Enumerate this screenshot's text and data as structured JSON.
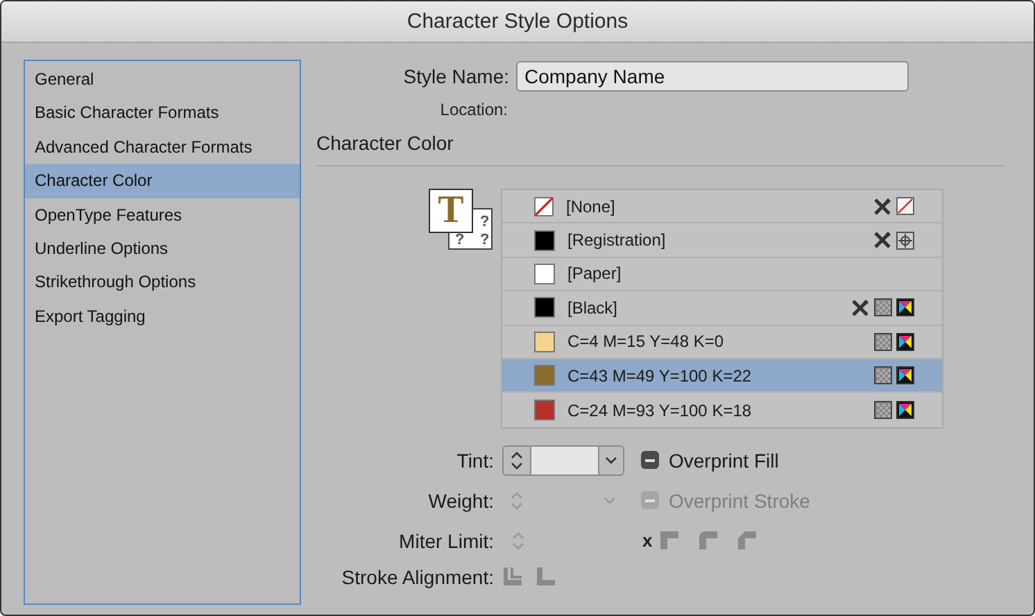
{
  "window": {
    "title": "Character Style Options"
  },
  "sidebar": {
    "items": [
      {
        "label": "General",
        "selected": false
      },
      {
        "label": "Basic Character Formats",
        "selected": false
      },
      {
        "label": "Advanced Character Formats",
        "selected": false
      },
      {
        "label": "Character Color",
        "selected": true
      },
      {
        "label": "OpenType Features",
        "selected": false
      },
      {
        "label": "Underline Options",
        "selected": false
      },
      {
        "label": "Strikethrough Options",
        "selected": false
      },
      {
        "label": "Export Tagging",
        "selected": false
      }
    ]
  },
  "style_name": {
    "label": "Style Name:",
    "value": "Company Name"
  },
  "location": {
    "label": "Location:"
  },
  "section_title": "Character Color",
  "fill_stroke": {
    "fill_letter": "T",
    "stroke_marks": [
      "?",
      "?",
      "?"
    ]
  },
  "swatches": [
    {
      "name": "[None]",
      "kind": "none",
      "locked": true,
      "selected": false
    },
    {
      "name": "[Registration]",
      "kind": "registration",
      "color": "#000000",
      "locked": true,
      "selected": false
    },
    {
      "name": "[Paper]",
      "kind": "paper",
      "color": "#ffffff",
      "locked": false,
      "selected": false
    },
    {
      "name": "[Black]",
      "kind": "process",
      "color": "#000000",
      "locked": true,
      "selected": false
    },
    {
      "name": "C=4 M=15 Y=48 K=0",
      "kind": "process",
      "color": "#f6d38c",
      "locked": false,
      "selected": false
    },
    {
      "name": "C=43 M=49 Y=100 K=22",
      "kind": "process",
      "color": "#8b6c2c",
      "locked": false,
      "selected": true
    },
    {
      "name": "C=24 M=93 Y=100 K=18",
      "kind": "process",
      "color": "#b3322a",
      "locked": false,
      "selected": false
    }
  ],
  "tint": {
    "label": "Tint:",
    "disabled": false
  },
  "overprint_fill": {
    "label": "Overprint Fill",
    "indeterminate": true,
    "disabled": false
  },
  "weight": {
    "label": "Weight:",
    "disabled": true
  },
  "overprint_stroke": {
    "label": "Overprint Stroke",
    "indeterminate": true,
    "disabled": true
  },
  "miter_limit": {
    "label": "Miter Limit:",
    "disabled": true,
    "unit": "x"
  },
  "stroke_alignment": {
    "label": "Stroke Alignment:"
  }
}
